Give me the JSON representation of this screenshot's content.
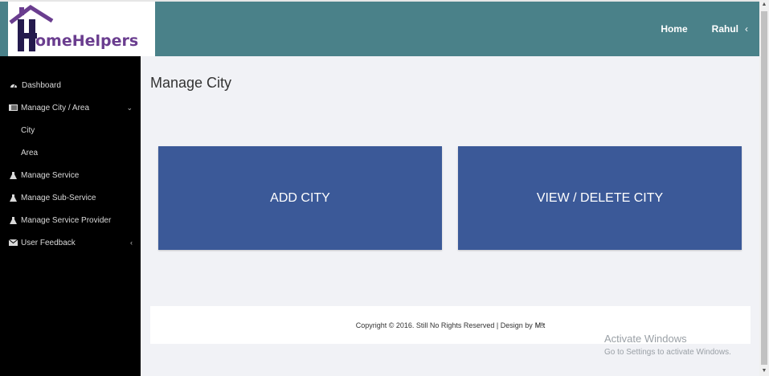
{
  "brand": {
    "logo_text": "omeHelpers",
    "logo_letter": "H",
    "color": "#6a3d8f"
  },
  "header": {
    "bg_color": "#4a8189",
    "nav": {
      "home": "Home",
      "user": "Rahul",
      "user_chevron": "‹"
    }
  },
  "sidebar": {
    "items": [
      {
        "label": "Dashboard",
        "icon": "tachometer-icon"
      },
      {
        "label": "Manage City / Area",
        "icon": "list-icon",
        "arrow": "⌄"
      },
      {
        "label": "City"
      },
      {
        "label": "Area"
      },
      {
        "label": "Manage Service",
        "icon": "flask-icon"
      },
      {
        "label": "Manage Sub-Service",
        "icon": "flask-icon"
      },
      {
        "label": "Manage Service Provider",
        "icon": "flask-icon"
      },
      {
        "label": "User Feedback",
        "icon": "envelope-icon",
        "arrow": "‹"
      }
    ]
  },
  "main": {
    "title": "Manage City",
    "cards": {
      "add": "ADD CITY",
      "view": "VIEW / DELETE CITY"
    },
    "card_color": "#3b5998",
    "footer": {
      "text": "Copyright © 2016. Still No Rights Reserved | Design by",
      "designer": "M!t"
    }
  },
  "watermark": {
    "line1": "Activate Windows",
    "line2": "Go to Settings to activate Windows."
  }
}
